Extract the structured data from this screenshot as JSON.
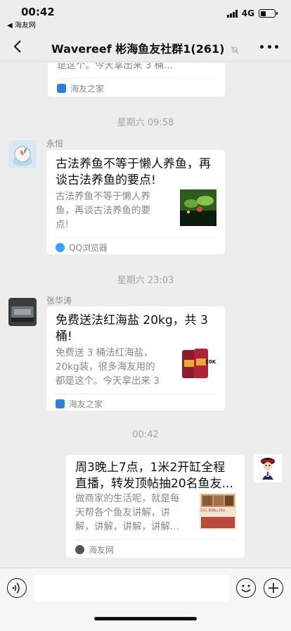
{
  "status_bar": {
    "time": "00:42",
    "back_app": "◀ 海友网",
    "network": "4G"
  },
  "nav": {
    "title": "Wavereef 彬海鱼友社群1(261)"
  },
  "messages": [
    {
      "desc_tail": "是这个。今天拿出来 3 桶...",
      "source": "海友之家",
      "source_icon_color": "#2f7fd6"
    },
    {
      "timestamp": "星期六 09:58"
    },
    {
      "sender": "永恒",
      "title": "古法养鱼不等于懒人养鱼，再谈古法养鱼的要点!",
      "desc": "古法养鱼不等于懒人养鱼，再谈古法养鱼的要点!",
      "source": "QQ浏览器",
      "source_icon_color": "#3aa0ff"
    },
    {
      "timestamp": "星期六 23:03"
    },
    {
      "sender": "张华涛",
      "title": "免费送法红海盐 20kg，共 3 桶!",
      "desc": "免费送 3 桶法红海盐，20kg装，很多海友用的都是这个。今天拿出来 3 桶...",
      "thumb_label": "20K",
      "source": "海友之家",
      "source_icon_color": "#2f7fd6"
    },
    {
      "timestamp": "00:42"
    },
    {
      "title": "周3晚上7点，1米2开缸全程直播，转发顶帖抽20名鱼友...",
      "desc": "做商家的生活呢，就是每天帮各个鱼友讲解，讲解，讲解，讲解，讲解...",
      "thumb_label": "22日, 周3晚上19点",
      "source": "海友网",
      "source_icon_color": "#555555"
    }
  ]
}
